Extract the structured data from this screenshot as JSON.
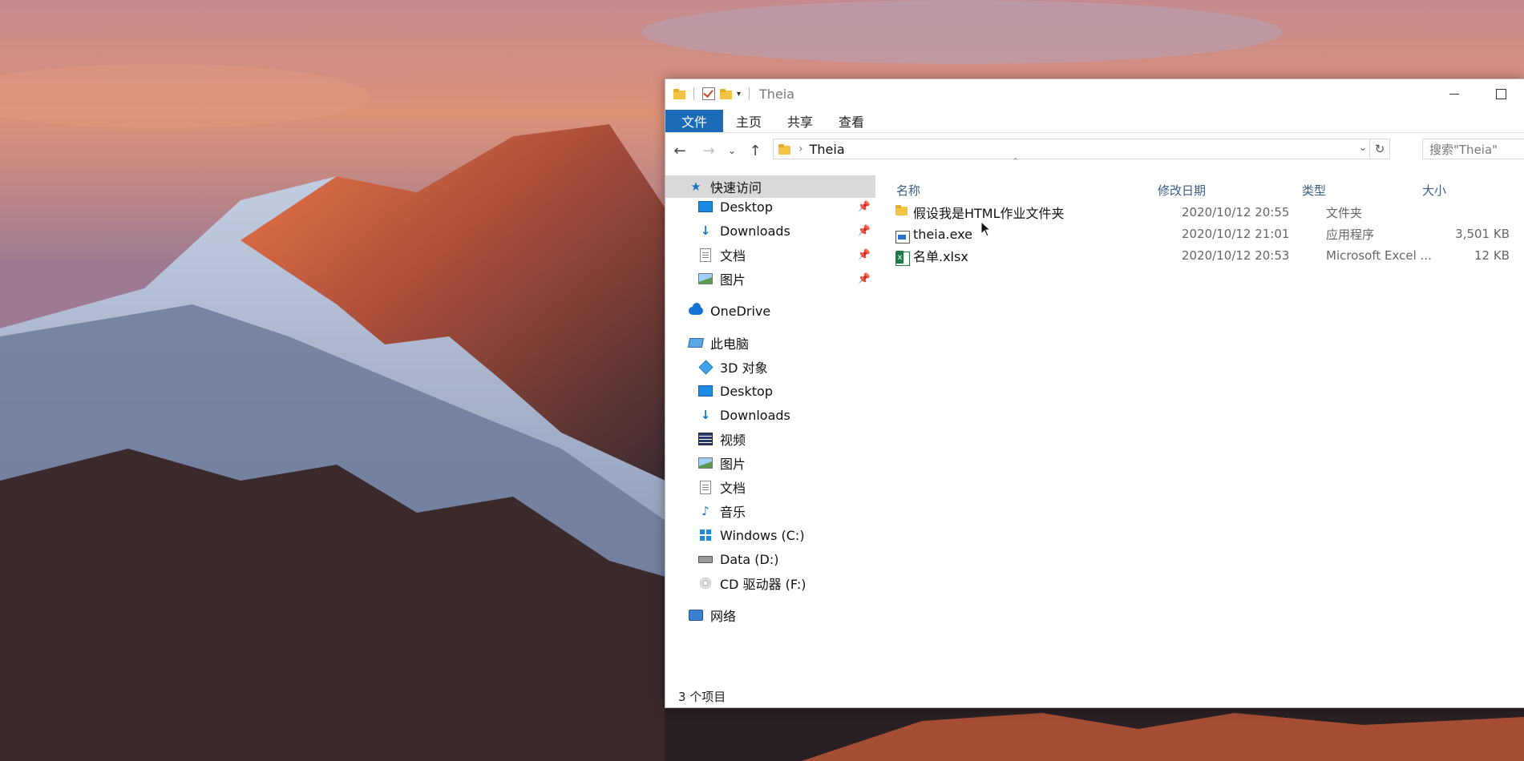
{
  "window": {
    "title": "Theia",
    "ribbon_tabs": [
      "文件",
      "主页",
      "共享",
      "查看"
    ],
    "address": {
      "crumb": "Theia"
    },
    "search_placeholder": "搜索\"Theia\""
  },
  "navpane": {
    "quick_access": "快速访问",
    "quick_items": [
      {
        "label": "Desktop",
        "icon": "desktop-icon",
        "pinned": true
      },
      {
        "label": "Downloads",
        "icon": "downloads-icon",
        "pinned": true
      },
      {
        "label": "文档",
        "icon": "documents-icon",
        "pinned": true
      },
      {
        "label": "图片",
        "icon": "pictures-icon",
        "pinned": true
      }
    ],
    "onedrive": "OneDrive",
    "this_pc": "此电脑",
    "pc_items": [
      {
        "label": "3D 对象",
        "icon": "3d-objects-icon"
      },
      {
        "label": "Desktop",
        "icon": "desktop-icon"
      },
      {
        "label": "Downloads",
        "icon": "downloads-icon"
      },
      {
        "label": "视频",
        "icon": "videos-icon"
      },
      {
        "label": "图片",
        "icon": "pictures-icon"
      },
      {
        "label": "文档",
        "icon": "documents-icon"
      },
      {
        "label": "音乐",
        "icon": "music-icon"
      },
      {
        "label": "Windows (C:)",
        "icon": "windows-drive-icon"
      },
      {
        "label": "Data (D:)",
        "icon": "drive-icon"
      },
      {
        "label": "CD 驱动器 (F:)",
        "icon": "cd-drive-icon"
      }
    ],
    "network": "网络"
  },
  "columns": {
    "name": "名称",
    "date": "修改日期",
    "type": "类型",
    "size": "大小"
  },
  "files": [
    {
      "name": "假设我是HTML作业文件夹",
      "date": "2020/10/12 20:55",
      "type": "文件夹",
      "size": "",
      "icon": "folder-icon"
    },
    {
      "name": "theia.exe",
      "date": "2020/10/12 21:01",
      "type": "应用程序",
      "size": "3,501 KB",
      "icon": "exe-icon"
    },
    {
      "name": "名单.xlsx",
      "date": "2020/10/12 20:53",
      "type": "Microsoft Excel ...",
      "size": "12 KB",
      "icon": "excel-icon"
    }
  ],
  "status": "3 个项目"
}
